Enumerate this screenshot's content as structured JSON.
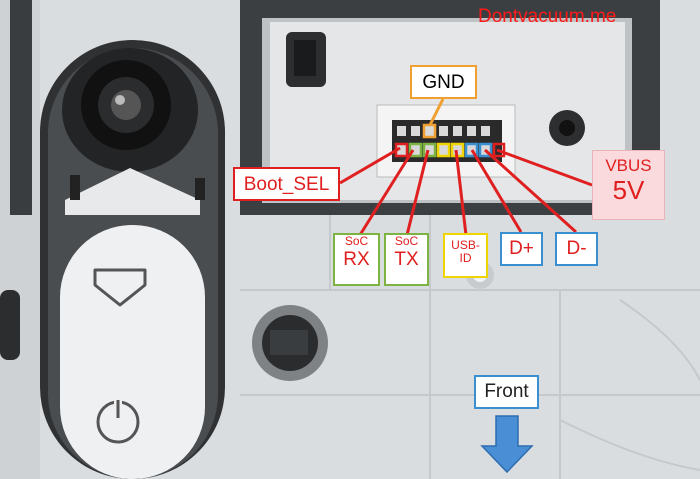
{
  "watermark": "Dontvacuum.me",
  "labels": {
    "gnd": "GND",
    "boot_sel": "Boot_SEL",
    "soc_rx": {
      "line1": "SoC",
      "line2": "RX"
    },
    "soc_tx": {
      "line1": "SoC",
      "line2": "TX"
    },
    "usb_id": {
      "line1": "USB-",
      "line2": "ID"
    },
    "d_plus": "D+",
    "d_minus": "D-",
    "vbus": {
      "line1": "VBUS",
      "line2": "5V"
    },
    "front": "Front"
  },
  "colors": {
    "red": "#e02020",
    "orange": "#f0a030",
    "green": "#7cb342",
    "yellow": "#f0d400",
    "blue": "#3a8fd0",
    "pink": "#fadadd"
  }
}
